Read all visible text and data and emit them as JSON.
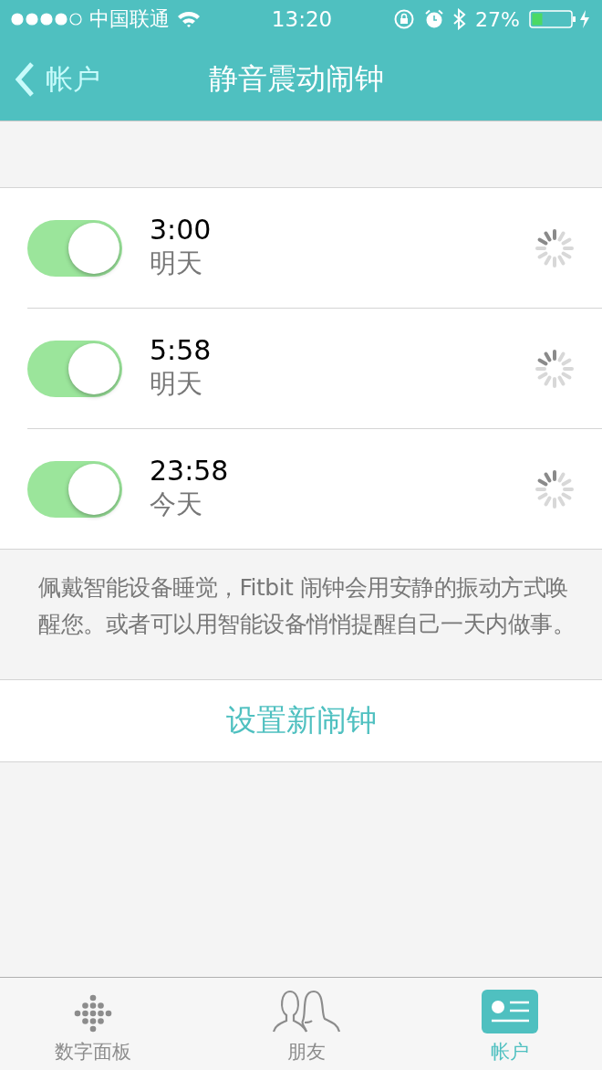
{
  "status_bar": {
    "carrier": "中国联通",
    "time": "13:20",
    "battery": "27%"
  },
  "nav": {
    "back": "帐户",
    "title": "静音震动闹钟"
  },
  "alarms": [
    {
      "time": "3:00",
      "day": "明天",
      "on": true
    },
    {
      "time": "5:58",
      "day": "明天",
      "on": true
    },
    {
      "time": "23:58",
      "day": "今天",
      "on": true
    }
  ],
  "description": "佩戴智能设备睡觉，Fitbit 闹钟会用安静的振动方式唤醒您。或者可以用智能设备悄悄提醒自己一天内做事。",
  "add_button": "设置新闹钟",
  "tabs": [
    {
      "kind": "dashboard",
      "label": "数字面板",
      "selected": false
    },
    {
      "kind": "friends",
      "label": "朋友",
      "selected": false
    },
    {
      "kind": "account",
      "label": "帐户",
      "selected": true
    }
  ]
}
